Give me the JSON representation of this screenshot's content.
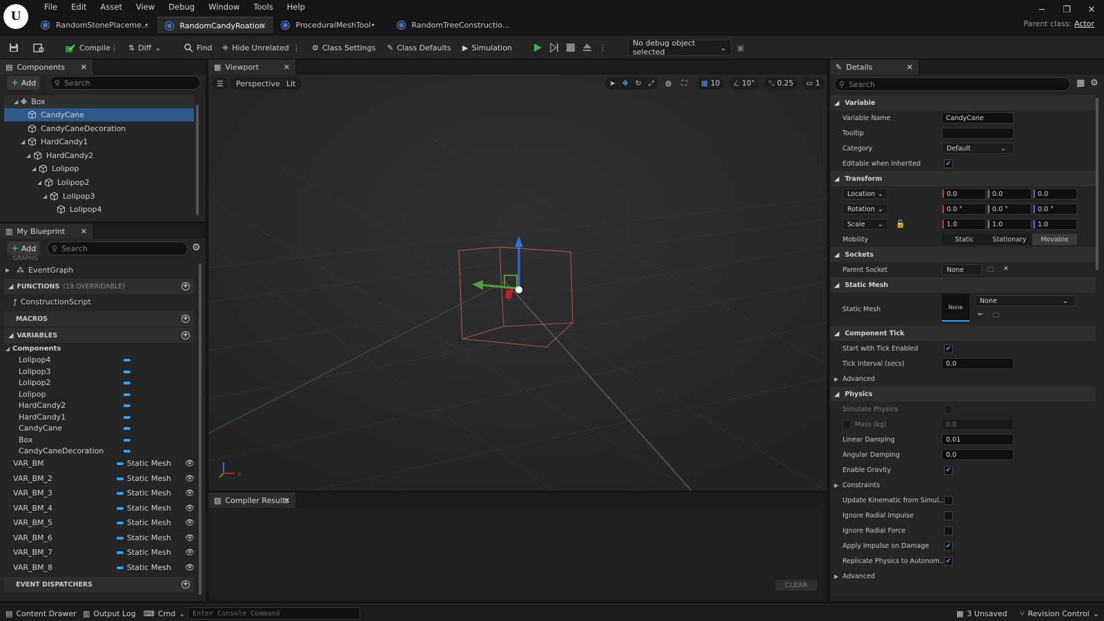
{
  "logo": "U",
  "menu": [
    "File",
    "Edit",
    "Asset",
    "View",
    "Debug",
    "Window",
    "Tools",
    "Help"
  ],
  "tabs": [
    {
      "label": "RandomStonePlaceme...",
      "suffix": "•",
      "active": false
    },
    {
      "label": "RandomCandyRoation",
      "suffix": "",
      "active": true
    },
    {
      "label": "ProceduralMeshTool•",
      "suffix": "",
      "active": false
    },
    {
      "label": "RandomTreeConstructio...",
      "suffix": "",
      "active": false
    }
  ],
  "parent_class": {
    "label": "Parent class:",
    "value": "Actor"
  },
  "toolbar": {
    "compile": "Compile",
    "diff": "Diff",
    "find": "Find",
    "hide_unrelated": "Hide Unrelated",
    "class_settings": "Class Settings",
    "class_defaults": "Class Defaults",
    "simulation": "Simulation",
    "debug_object": "No debug object selected"
  },
  "components": {
    "title": "Components",
    "add": "Add",
    "search_placeholder": "Search",
    "items": [
      {
        "label": "Box",
        "depth": 0
      },
      {
        "label": "CandyCane",
        "depth": 1,
        "selected": true
      },
      {
        "label": "CandyCaneDecoration",
        "depth": 1
      },
      {
        "label": "HardCandy1",
        "depth": 1
      },
      {
        "label": "HardCandy2",
        "depth": 2
      },
      {
        "label": "Lolipop",
        "depth": 3
      },
      {
        "label": "Lolipop2",
        "depth": 4
      },
      {
        "label": "Lolipop3",
        "depth": 5
      },
      {
        "label": "Lolipop4",
        "depth": 6
      }
    ]
  },
  "my_blueprint": {
    "title": "My Blueprint",
    "add": "Add",
    "search_placeholder": "Search",
    "graphs_label": "GRAPHS",
    "event_graph": "EventGraph",
    "functions": "FUNCTIONS",
    "functions_note": "(19 OVERRIDABLE)",
    "construction_script": "ConstructionScript",
    "macros": "MACROS",
    "variables": "VARIABLES",
    "components_group": "Components",
    "component_vars": [
      "Lolipop4",
      "Lolipop3",
      "Lolipop2",
      "Lolipop",
      "HardCandy2",
      "HardCandy1",
      "CandyCane",
      "Box",
      "CandyCaneDecoration"
    ],
    "vars": [
      {
        "name": "VAR_BM",
        "type": "Static Mesh"
      },
      {
        "name": "VAR_BM_2",
        "type": "Static Mesh"
      },
      {
        "name": "VAR_BM_3",
        "type": "Static Mesh"
      },
      {
        "name": "VAR_BM_4",
        "type": "Static Mesh"
      },
      {
        "name": "VAR_BM_5",
        "type": "Static Mesh"
      },
      {
        "name": "VAR_BM_6",
        "type": "Static Mesh"
      },
      {
        "name": "VAR_BM_7",
        "type": "Static Mesh"
      },
      {
        "name": "VAR_BM_8",
        "type": "Static Mesh"
      }
    ],
    "event_dispatchers": "EVENT DISPATCHERS"
  },
  "viewport": {
    "title": "Viewport",
    "perspective": "Perspective",
    "lit": "Lit",
    "grid_snap": "10",
    "rot_snap": "10°",
    "scale_snap": "0.25",
    "camera_speed": "1"
  },
  "compiler": {
    "title": "Compiler Results",
    "clear": "CLEAR"
  },
  "details": {
    "title": "Details",
    "search_placeholder": "Search",
    "variable_section": "Variable",
    "variable_name_label": "Variable Name",
    "variable_name": "CandyCane",
    "tooltip_label": "Tooltip",
    "tooltip": "",
    "category_label": "Category",
    "category": "Default",
    "editable_label": "Editable when Inherited",
    "transform_section": "Transform",
    "location_label": "Location",
    "location": [
      "0.0",
      "0.0",
      "0.0"
    ],
    "rotation_label": "Rotation",
    "rotation": [
      "0.0 °",
      "0.0 °",
      "0.0 °"
    ],
    "scale_label": "Scale",
    "scale": [
      "1.0",
      "1.0",
      "1.0"
    ],
    "mobility_label": "Mobility",
    "mobility": [
      "Static",
      "Stationary",
      "Movable"
    ],
    "sockets_section": "Sockets",
    "parent_socket_label": "Parent Socket",
    "parent_socket": "None",
    "static_mesh_section": "Static Mesh",
    "static_mesh_label": "Static Mesh",
    "static_mesh_thumb": "None",
    "static_mesh_value": "None",
    "component_tick_section": "Component Tick",
    "start_tick_label": "Start with Tick Enabled",
    "tick_interval_label": "Tick Interval (secs)",
    "tick_interval": "0.0",
    "advanced": "Advanced",
    "physics_section": "Physics",
    "simulate_physics_label": "Simulate Physics",
    "mass_label": "Mass (kg)",
    "mass": "0.0",
    "linear_damping_label": "Linear Damping",
    "linear_damping": "0.01",
    "angular_damping_label": "Angular Damping",
    "angular_damping": "0.0",
    "enable_gravity_label": "Enable Gravity",
    "constraints": "Constraints",
    "update_kinematic_label": "Update Kinematic from Simul...",
    "ignore_radial_impulse_label": "Ignore Radial Impulse",
    "ignore_radial_force_label": "Ignore Radial Force",
    "apply_impulse_label": "Apply Impulse on Damage",
    "replicate_physics_label": "Replicate Physics to Autonom...",
    "advanced2": "Advanced"
  },
  "statusbar": {
    "content_drawer": "Content Drawer",
    "output_log": "Output Log",
    "cmd": "Cmd",
    "console_placeholder": "Enter Console Command",
    "unsaved": "3 Unsaved",
    "revision": "Revision Control"
  },
  "colors": {
    "accent": "#2d5a8a",
    "play": "#39b54a",
    "var_pill": "#2aa4ff"
  }
}
